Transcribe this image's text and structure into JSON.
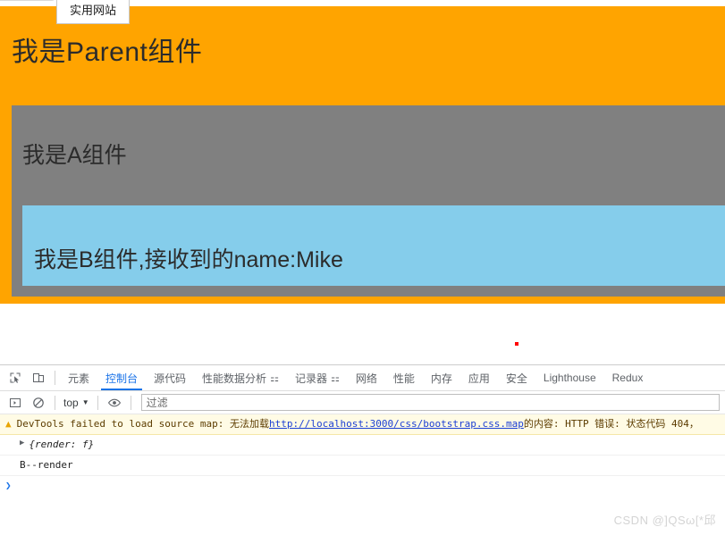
{
  "page": {
    "tooltip_chip": "实用网站",
    "parent_title": "我是Parent组件",
    "a_title": "我是A组件",
    "b_title": "我是B组件,接收到的name:Mike",
    "colors": {
      "parent_bg": "#ffa400",
      "a_bg": "#808080",
      "b_bg": "#85cdeb",
      "text": "#2b2b2b"
    }
  },
  "devtools": {
    "left_icons": [
      {
        "name": "inspect-element-icon",
        "glyph": "⬚"
      },
      {
        "name": "device-toolbar-icon",
        "glyph": "❐"
      }
    ],
    "tabs": [
      {
        "label": "元素",
        "active": false,
        "flask": false
      },
      {
        "label": "控制台",
        "active": true,
        "flask": false
      },
      {
        "label": "源代码",
        "active": false,
        "flask": false
      },
      {
        "label": "性能数据分析",
        "active": false,
        "flask": true
      },
      {
        "label": "记录器",
        "active": false,
        "flask": true
      },
      {
        "label": "网络",
        "active": false,
        "flask": false
      },
      {
        "label": "性能",
        "active": false,
        "flask": false
      },
      {
        "label": "内存",
        "active": false,
        "flask": false
      },
      {
        "label": "应用",
        "active": false,
        "flask": false
      },
      {
        "label": "安全",
        "active": false,
        "flask": false
      },
      {
        "label": "Lighthouse",
        "active": false,
        "flask": false
      },
      {
        "label": "Redux",
        "active": false,
        "flask": false
      }
    ],
    "toolbar": {
      "sidebar_toggle": "▶|",
      "clear_console": "🚫",
      "context": "top",
      "caret": "▼",
      "eye": "👁",
      "filter_placeholder": "过滤"
    },
    "console": {
      "warning": {
        "icon": "⚠",
        "text_before_link": "DevTools failed to load source map: 无法加载 ",
        "link": "http://localhost:3000/css/bootstrap.css.map",
        "text_after_link": " 的内容: HTTP 错误: 状态代码 404，"
      },
      "entries": [
        {
          "type": "object",
          "arrow": "▶",
          "text": "{render: f}"
        },
        {
          "type": "log",
          "text": "B--render"
        }
      ],
      "prompt": "❯"
    },
    "accent_color": "#1a73e8"
  },
  "watermark": "CSDN @]QSω[*邱"
}
